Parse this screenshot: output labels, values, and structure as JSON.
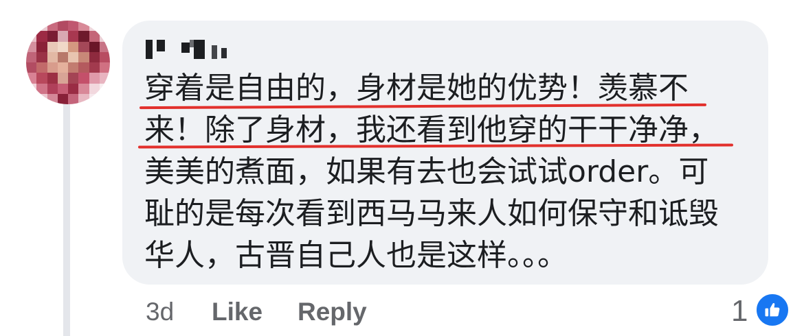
{
  "comment": {
    "author": "",
    "lines": [
      "穿着是自由的，身材是她的优势！羡慕不",
      "来！除了身材，我还看到他穿的干干净净，",
      "美美的煮面，如果有去也会试试order。可",
      "耻的是每次看到西马马来人如何保守和诋毁",
      "华人，古晋自己人也是这样。。。"
    ],
    "highlight_color": "#e2302c"
  },
  "actions": {
    "time": "3d",
    "like_label": "Like",
    "reply_label": "Reply"
  },
  "reactions": {
    "count": "1",
    "icon": "thumbs-up-icon",
    "color": "#1877f2"
  },
  "colors": {
    "bubble": "#f0f2f5",
    "text": "#1c1e21",
    "muted": "#65676b"
  }
}
